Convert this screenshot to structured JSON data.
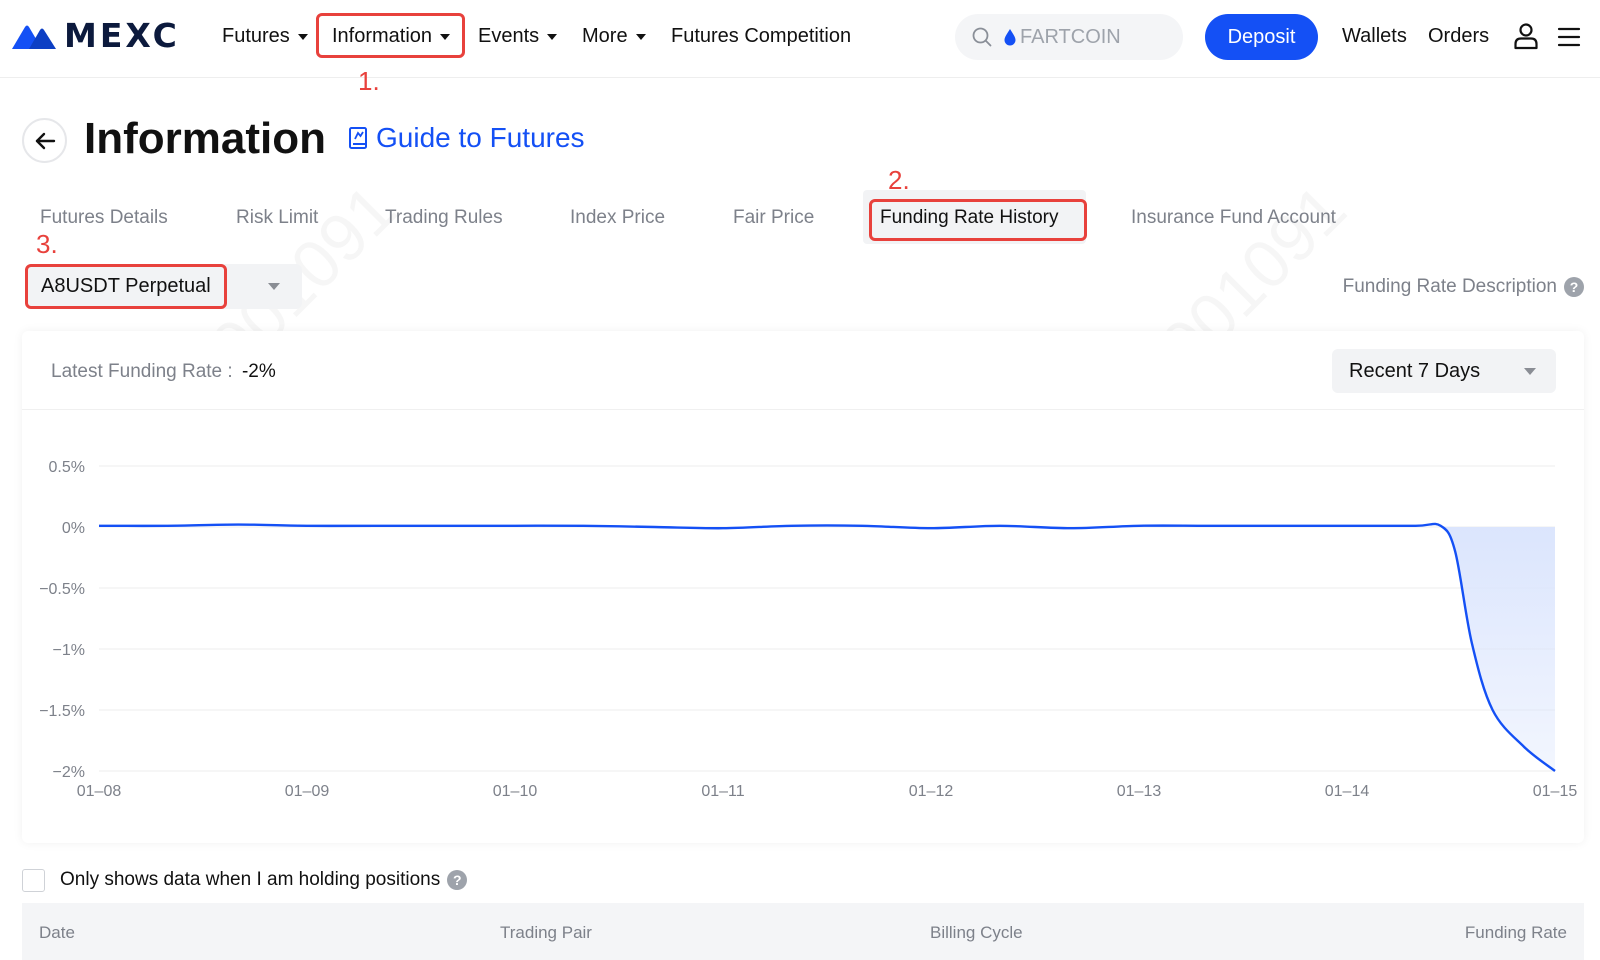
{
  "nav": {
    "brand": "MEXC",
    "items": [
      {
        "label": "Futures",
        "has_caret": true
      },
      {
        "label": "Information",
        "has_caret": true
      },
      {
        "label": "Events",
        "has_caret": true
      },
      {
        "label": "More",
        "has_caret": true
      },
      {
        "label": "Futures Competition",
        "has_caret": false
      }
    ],
    "search_text": "FARTCOIN",
    "deposit_label": "Deposit",
    "wallets_label": "Wallets",
    "orders_label": "Orders",
    "icons": [
      "search-icon",
      "drop-icon",
      "user-icon",
      "menu-icon"
    ],
    "accent_color": "#1450f5"
  },
  "annotations": {
    "color": "#e8413c",
    "step1": "1.",
    "step2": "2.",
    "step3": "3."
  },
  "page": {
    "title": "Information",
    "guide_link": "Guide to Futures",
    "tabs": [
      {
        "label": "Futures Details",
        "active": false
      },
      {
        "label": "Risk Limit",
        "active": false
      },
      {
        "label": "Trading Rules",
        "active": false
      },
      {
        "label": "Index Price",
        "active": false
      },
      {
        "label": "Fair Price",
        "active": false
      },
      {
        "label": "Funding Rate History",
        "active": true
      },
      {
        "label": "Insurance Fund Account",
        "active": false
      }
    ],
    "contract_selected": "A8USDT Perpetual",
    "funding_rate_description": "Funding Rate Description",
    "latest_funding_rate_label": "Latest Funding Rate :",
    "latest_funding_rate_value": "-2%",
    "period_selected": "Recent 7 Days"
  },
  "chart_data": {
    "type": "area",
    "title": "",
    "xlabel": "",
    "ylabel": "",
    "x_ticks": [
      "01–08",
      "01–09",
      "01–10",
      "01–11",
      "01–12",
      "01–13",
      "01–14",
      "01–15"
    ],
    "y_ticks": [
      "0.5%",
      "0%",
      "−0.5%",
      "−1%",
      "−1.5%",
      "−2%"
    ],
    "y_tick_values": [
      0.5,
      0,
      -0.5,
      -1,
      -1.5,
      -2
    ],
    "ylim": [
      -2,
      0.5
    ],
    "grid": true,
    "line_color": "#1450f5",
    "fill_color": "#dbe5fd",
    "series": [
      {
        "x": [
          0,
          0.33,
          0.67,
          1,
          1.33,
          1.67,
          2,
          2.33,
          2.67,
          3,
          3.33,
          3.67,
          4,
          4.33,
          4.67,
          5,
          5.33,
          5.67,
          6,
          6.33,
          6.45,
          6.52,
          6.6,
          6.7,
          6.85,
          7
        ],
        "values": [
          0.01,
          0.01,
          0.02,
          0.01,
          0.01,
          0.01,
          0.01,
          0.01,
          0.0,
          -0.01,
          0.01,
          0.01,
          -0.01,
          0.01,
          -0.01,
          0.01,
          0.01,
          0.01,
          0.01,
          0.01,
          0.01,
          -0.2,
          -0.95,
          -1.5,
          -1.8,
          -2.0
        ]
      }
    ]
  },
  "filters": {
    "holding_only_label": "Only shows data when I am holding positions"
  },
  "table": {
    "columns": [
      "Date",
      "Trading Pair",
      "Billing Cycle",
      "Funding Rate"
    ]
  },
  "watermark": "PC-001091"
}
